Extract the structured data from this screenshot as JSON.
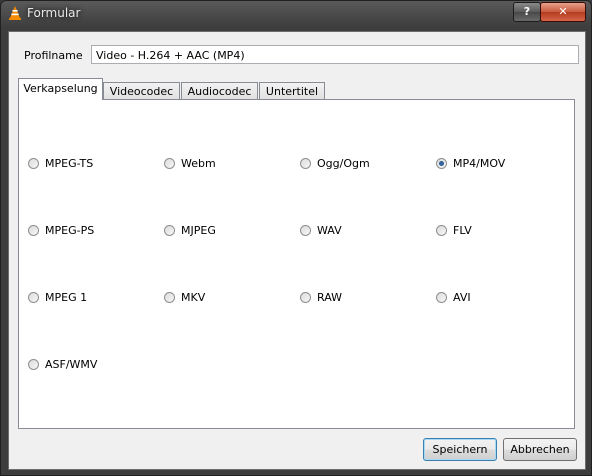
{
  "window": {
    "title": "Formular",
    "help_label": "?",
    "close_label": "✕"
  },
  "profile": {
    "label": "Profilname",
    "value": "Video - H.264 + AAC (MP4)"
  },
  "tabs": [
    {
      "label": "Verkapselung",
      "active": true
    },
    {
      "label": "Videocodec",
      "active": false
    },
    {
      "label": "Audiocodec",
      "active": false
    },
    {
      "label": "Untertitel",
      "active": false
    }
  ],
  "options": [
    {
      "label": "MPEG-TS",
      "selected": false
    },
    {
      "label": "Webm",
      "selected": false
    },
    {
      "label": "Ogg/Ogm",
      "selected": false
    },
    {
      "label": "MP4/MOV",
      "selected": true
    },
    {
      "label": "MPEG-PS",
      "selected": false
    },
    {
      "label": "MJPEG",
      "selected": false
    },
    {
      "label": "WAV",
      "selected": false
    },
    {
      "label": "FLV",
      "selected": false
    },
    {
      "label": "MPEG 1",
      "selected": false
    },
    {
      "label": "MKV",
      "selected": false
    },
    {
      "label": "RAW",
      "selected": false
    },
    {
      "label": "AVI",
      "selected": false
    },
    {
      "label": "ASF/WMV",
      "selected": false
    }
  ],
  "buttons": {
    "save": "Speichern",
    "cancel": "Abbrechen"
  },
  "colors": {
    "selected_radio": "#1c4f8a",
    "close_button": "#c75a3e",
    "default_button_border": "#3c7fb1"
  },
  "icons": {
    "app": "vlc-cone-icon"
  }
}
